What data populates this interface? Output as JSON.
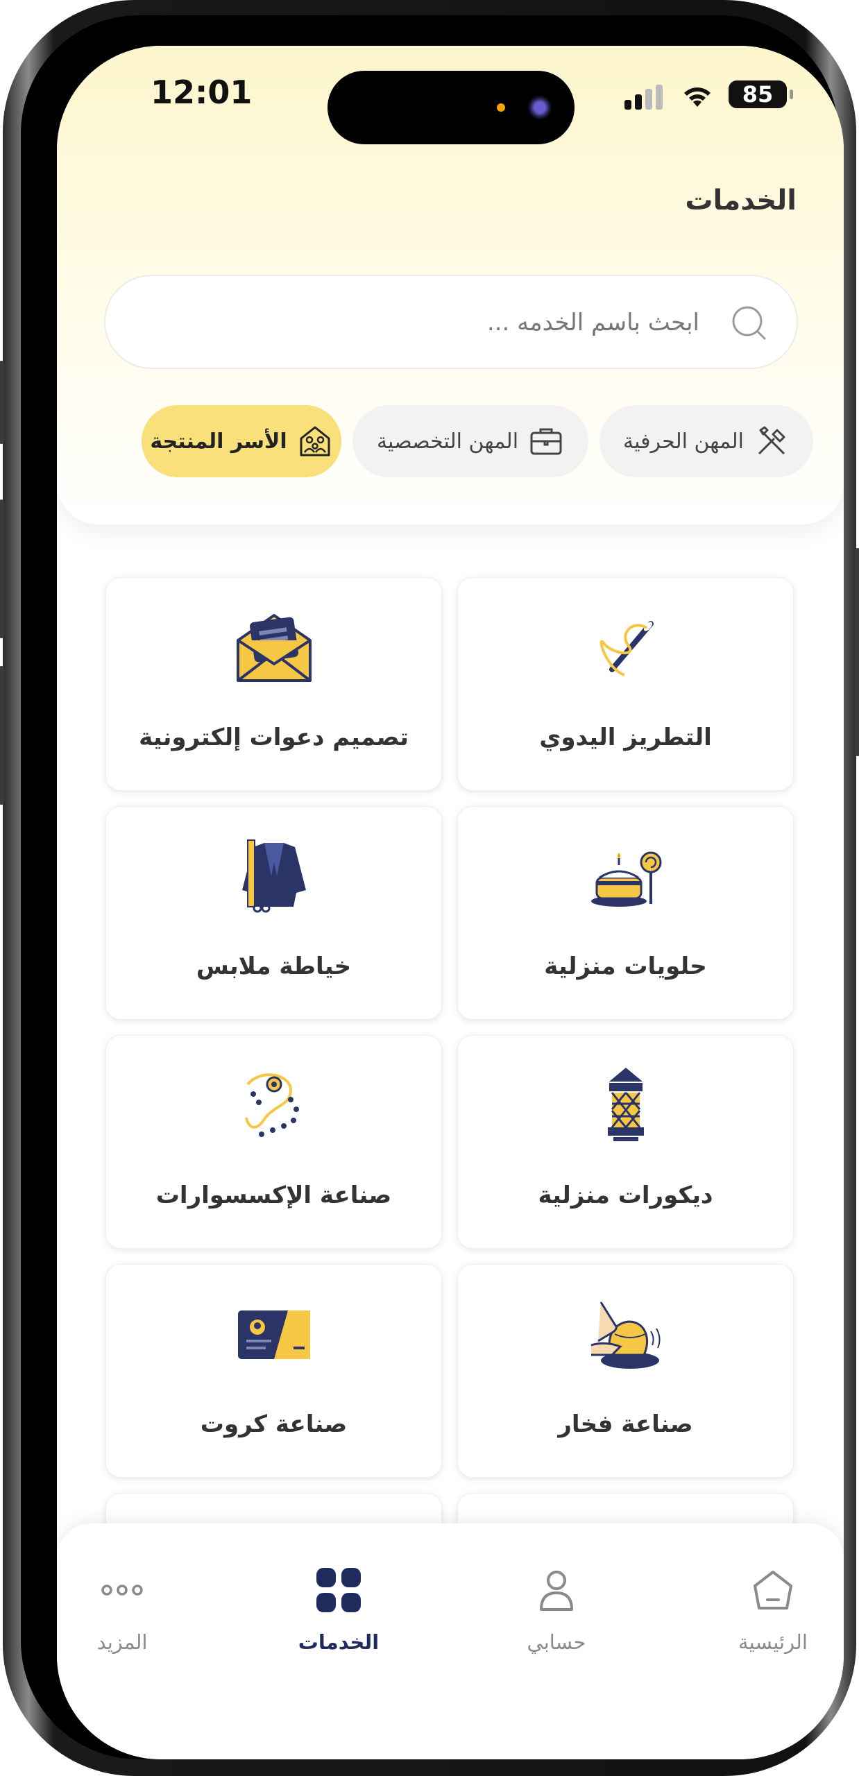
{
  "status_bar": {
    "time": "12:01",
    "battery": "85"
  },
  "header": {
    "title": "الخدمات"
  },
  "search": {
    "placeholder": "ابحث باسم الخدمه ..."
  },
  "categories": [
    {
      "label": "المهن الحرفية",
      "icon": "tools-icon",
      "active": false
    },
    {
      "label": "المهن التخصصية",
      "icon": "briefcase-icon",
      "active": false
    },
    {
      "label": "الأسر المنتجة",
      "icon": "family-home-icon",
      "active": true
    }
  ],
  "services": [
    {
      "label": "التطريز اليدوي",
      "icon": "embroidery-needle-icon"
    },
    {
      "label": "تصميم دعوات إلكترونية",
      "icon": "invitation-envelope-icon"
    },
    {
      "label": "حلويات منزلية",
      "icon": "cake-icon"
    },
    {
      "label": "خياطة ملابس",
      "icon": "tailoring-jacket-icon"
    },
    {
      "label": "ديكورات منزلية",
      "icon": "lantern-icon"
    },
    {
      "label": "صناعة الإكسسوارات",
      "icon": "necklace-icon"
    },
    {
      "label": "صناعة فخار",
      "icon": "pottery-icon"
    },
    {
      "label": "صناعة كروت",
      "icon": "card-icon"
    }
  ],
  "bottom_nav": [
    {
      "label": "الرئيسية",
      "icon": "home-icon",
      "active": false
    },
    {
      "label": "حسابي",
      "icon": "user-icon",
      "active": false
    },
    {
      "label": "الخدمات",
      "icon": "grid-icon",
      "active": true
    },
    {
      "label": "المزيد",
      "icon": "more-icon",
      "active": false
    }
  ],
  "colors": {
    "accent_yellow": "#F9E07A",
    "navy": "#1F2B5C",
    "icon_yellow": "#F6C744"
  }
}
